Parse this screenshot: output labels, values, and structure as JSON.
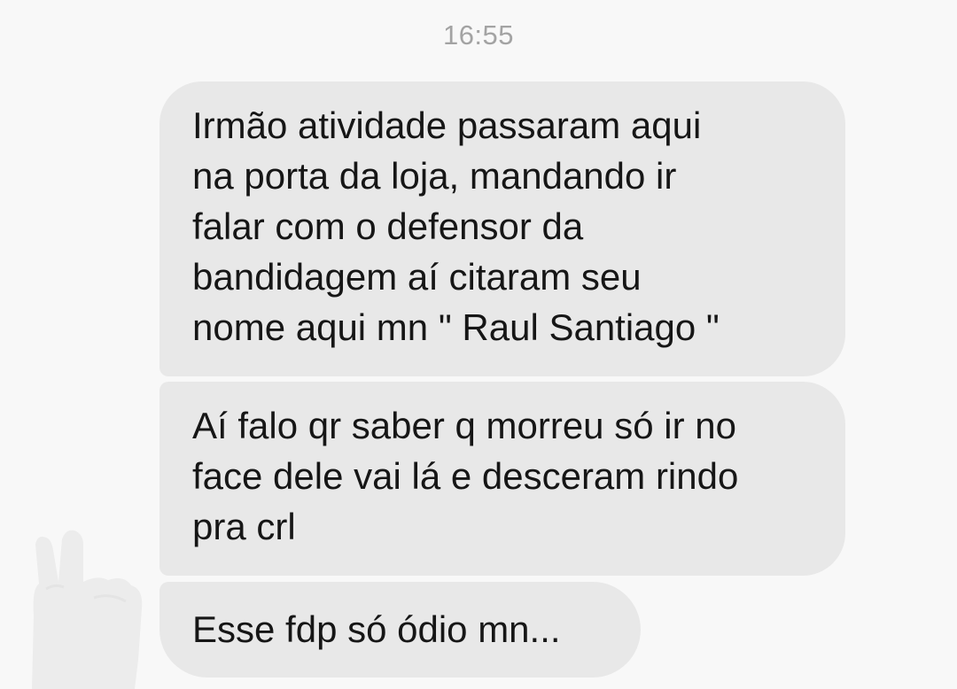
{
  "conversation": {
    "timestamp": "16:55",
    "messages": [
      {
        "lines": [
          "Irmão atividade passaram aqui",
          "na porta da loja,  mandando ir",
          "falar com o defensor da",
          "bandidagem aí citaram seu",
          "nome aqui mn \" Raul Santiago \""
        ]
      },
      {
        "lines": [
          "Aí falo qr saber q morreu só ir no",
          "face dele vai lá e desceram rindo",
          "pra crl"
        ]
      },
      {
        "lines": [
          "Esse fdp só ódio mn..."
        ]
      }
    ]
  },
  "colors": {
    "background": "#f8f8f8",
    "bubble": "#e8e8e8",
    "text": "#161616",
    "timestamp": "#a3a3a3"
  },
  "icons": {
    "avatar": "hand-peace-sign-icon"
  }
}
